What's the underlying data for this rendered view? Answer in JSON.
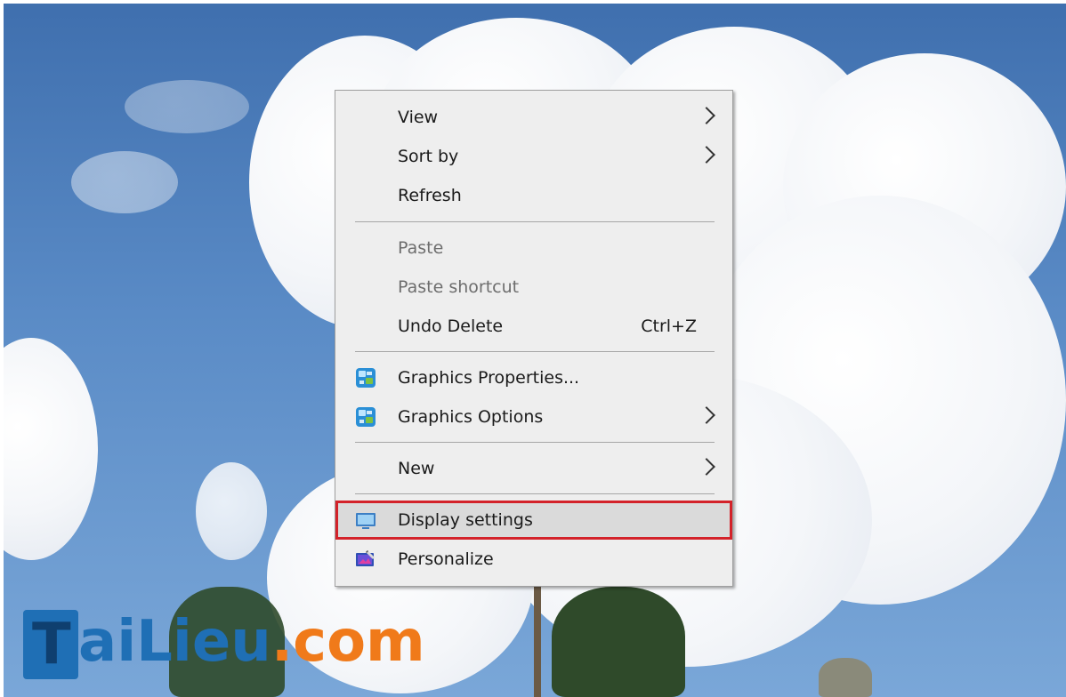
{
  "menu": {
    "items": [
      {
        "label": "View",
        "submenu": true,
        "enabled": true
      },
      {
        "label": "Sort by",
        "submenu": true,
        "enabled": true
      },
      {
        "label": "Refresh",
        "submenu": false,
        "enabled": true
      },
      {
        "label": "Paste",
        "submenu": false,
        "enabled": false
      },
      {
        "label": "Paste shortcut",
        "submenu": false,
        "enabled": false
      },
      {
        "label": "Undo Delete",
        "shortcut": "Ctrl+Z",
        "submenu": false,
        "enabled": true
      },
      {
        "label": "Graphics Properties...",
        "icon": "intel-graphics-icon",
        "submenu": false,
        "enabled": true
      },
      {
        "label": "Graphics Options",
        "icon": "intel-graphics-icon",
        "submenu": true,
        "enabled": true
      },
      {
        "label": "New",
        "submenu": true,
        "enabled": true
      },
      {
        "label": "Display settings",
        "icon": "display-monitor-icon",
        "submenu": false,
        "enabled": true,
        "highlighted": true
      },
      {
        "label": "Personalize",
        "icon": "personalize-icon",
        "submenu": false,
        "enabled": true
      }
    ]
  },
  "watermark": {
    "logo_letter": "T",
    "text_blue": "aiLieu",
    "text_orange": ".com"
  },
  "colors": {
    "highlight_border": "#d3222a",
    "menu_background": "#eeeeee",
    "logo_blue": "#1f6fb5",
    "logo_orange": "#f07a1a"
  }
}
